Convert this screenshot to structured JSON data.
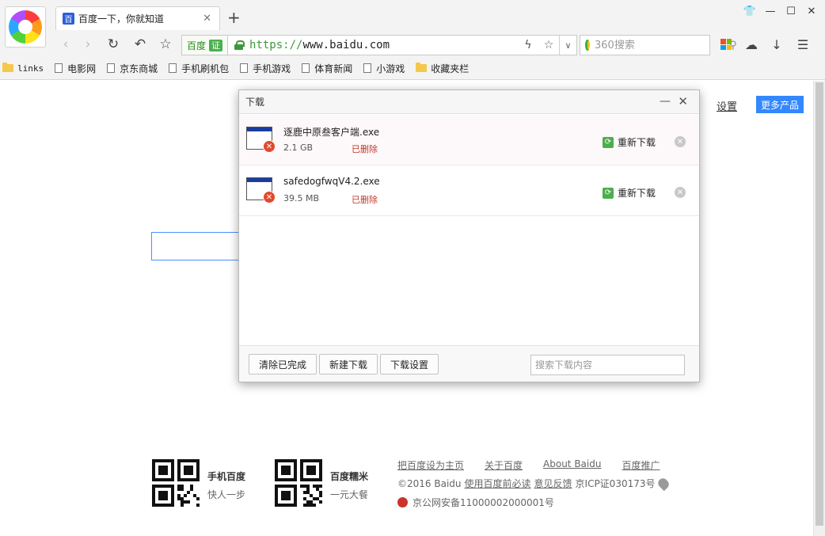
{
  "tab": {
    "title": "百度一下，你就知道",
    "favicon": "百"
  },
  "address_bar": {
    "ev_name": "百度",
    "ev_badge": "证",
    "url_protocol": "https://",
    "url_rest": "www.baidu.com"
  },
  "search": {
    "placeholder": "360搜索"
  },
  "bookmarks": [
    {
      "label": "links",
      "icon": "folder-icon"
    },
    {
      "label": "电影网",
      "icon": "page-icon"
    },
    {
      "label": "京东商城",
      "icon": "page-icon"
    },
    {
      "label": "手机刷机包",
      "icon": "page-icon"
    },
    {
      "label": "手机游戏",
      "icon": "page-icon"
    },
    {
      "label": "体育新闻",
      "icon": "page-icon"
    },
    {
      "label": "小游戏",
      "icon": "page-icon"
    },
    {
      "label": "收藏夹栏",
      "icon": "folder-icon"
    }
  ],
  "page": {
    "settings_link": "设置",
    "more_products": "更多产品",
    "qr_blocks": [
      {
        "title": "手机百度",
        "subtitle": "快人一步"
      },
      {
        "title": "百度糯米",
        "subtitle": "一元大餐"
      }
    ],
    "footer_links": [
      "把百度设为主页",
      "关于百度",
      "About Baidu",
      "百度推广"
    ],
    "footer_copyright": "©2016 Baidu",
    "footer_use": "使用百度前必读",
    "footer_feedback": "意见反馈",
    "footer_icp": "京ICP证030173号",
    "footer_police": "京公网安备11000002000001号"
  },
  "download_dialog": {
    "title": "下载",
    "items": [
      {
        "name": "逐鹿中原叁客户端.exe",
        "size": "2.1 GB",
        "status": "已删除",
        "action": "重新下载"
      },
      {
        "name": "safedogfwqV4.2.exe",
        "size": "39.5 MB",
        "status": "已删除",
        "action": "重新下载"
      }
    ],
    "footer": {
      "clear_label": "清除已完成",
      "new_label": "新建下载",
      "settings_label": "下载设置",
      "search_placeholder": "搜索下载内容"
    }
  },
  "colors": {
    "accent_blue": "#3388ff",
    "error_red": "#e24a2d",
    "status_red": "#c0392b",
    "success_green": "#4cae4c"
  }
}
